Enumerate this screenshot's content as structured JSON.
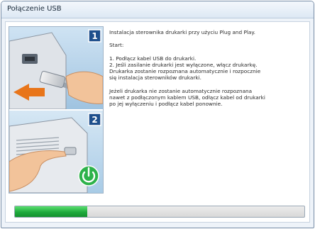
{
  "window": {
    "title": "Połączenie USB"
  },
  "illustration": {
    "step1_label": "1",
    "step2_label": "2",
    "power_icon": "power-icon",
    "colors": {
      "step_badge": "#1e4f8c",
      "arrow": "#e8751a",
      "power": "#2db24a"
    }
  },
  "instructions": {
    "intro": "Instalacja sterownika drukarki przy użyciu Plug and Play.",
    "start_label": "Start:",
    "step1": "1. Podłącz kabel USB do drukarki.",
    "step2_lines": [
      "2. Jeśli zasilanie drukarki jest wyłączone, włącz drukarkę.",
      "Drukarka zostanie rozpoznana automatycznie i rozpocznie",
      "się instalacja sterowników drukarki."
    ],
    "note_lines": [
      "Jeżeli drukarka nie zostanie automatycznie rozpoznana",
      "nawet z podłączonym kablem USB, odłącz kabel od drukarki",
      "po jej wyłączeniu i podłącz kabel ponownie."
    ]
  },
  "progress": {
    "fraction": 0.25,
    "color": "#1faa3c"
  }
}
